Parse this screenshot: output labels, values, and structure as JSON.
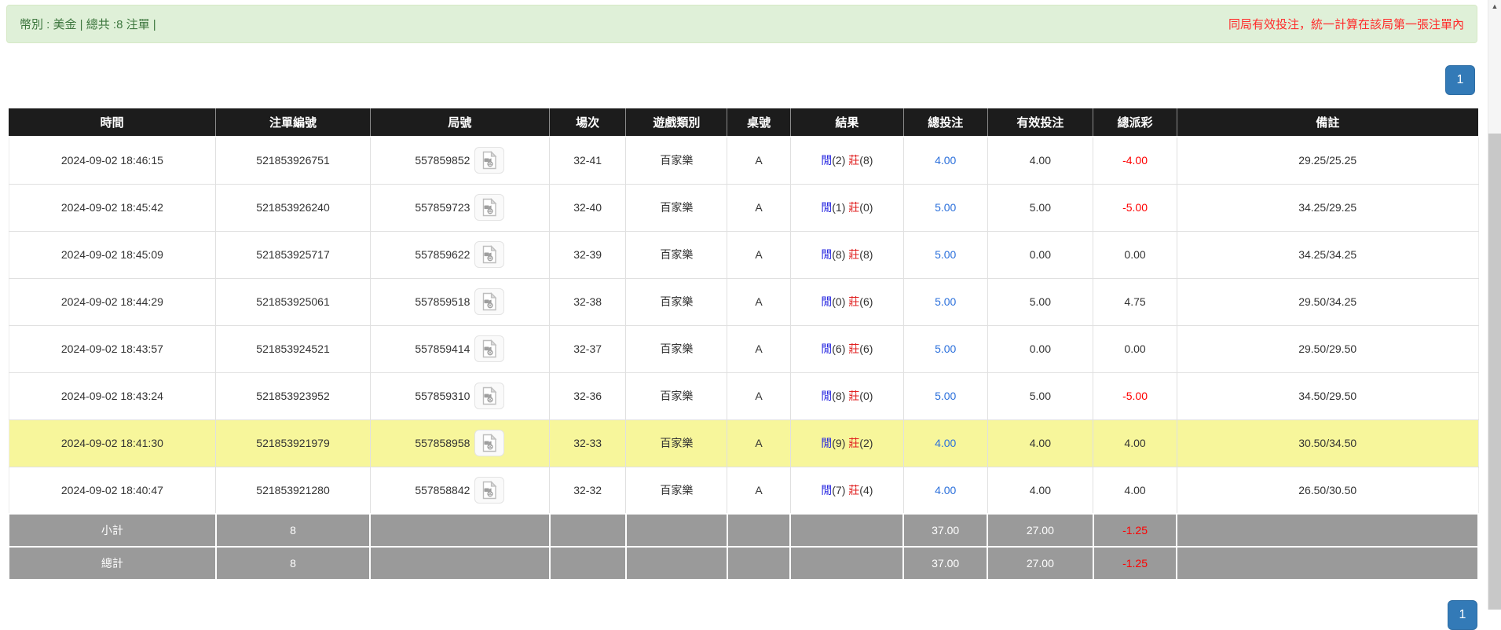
{
  "alert": {
    "left_text": "幣別 : 美金 | 總共 :8 注單 |",
    "right_text": "同局有效投注，統一計算在該局第一張注單內"
  },
  "pagination": {
    "page": "1"
  },
  "icons": {
    "video_replay": "video-file-icon",
    "scroll_up": "up-arrow"
  },
  "colors": {
    "pagination_blue": "#337ab7",
    "bet_amount_blue": "#2a6fdb",
    "player_blue": "#2525e0",
    "banker_red": "#e02020",
    "negative_red": "#ff0000",
    "highlight_yellow": "#f7f69b",
    "footer_gray": "#9a9a9a",
    "alert_bg_green": "#dff0d8",
    "alert_text_green": "#3c763d",
    "alert_text_red": "#ff2a2a",
    "header_black": "#1c1c1c"
  },
  "table": {
    "headers": [
      "時間",
      "注單編號",
      "局號",
      "場次",
      "遊戲類別",
      "桌號",
      "結果",
      "總投注",
      "有效投注",
      "總派彩",
      "備註"
    ],
    "result_labels": {
      "player": "閒",
      "banker": "莊"
    },
    "rows": [
      {
        "time": "2024-09-02 18:46:15",
        "bet_id": "521853926751",
        "round_id": "557859852",
        "session": "32-41",
        "game": "百家樂",
        "table_no": "A",
        "player_pts": "(2)",
        "banker_pts": "(8)",
        "total_bet": "4.00",
        "valid_bet": "4.00",
        "payout": "-4.00",
        "remark": "29.25/25.25",
        "highlight": false
      },
      {
        "time": "2024-09-02 18:45:42",
        "bet_id": "521853926240",
        "round_id": "557859723",
        "session": "32-40",
        "game": "百家樂",
        "table_no": "A",
        "player_pts": "(1)",
        "banker_pts": "(0)",
        "total_bet": "5.00",
        "valid_bet": "5.00",
        "payout": "-5.00",
        "remark": "34.25/29.25",
        "highlight": false
      },
      {
        "time": "2024-09-02 18:45:09",
        "bet_id": "521853925717",
        "round_id": "557859622",
        "session": "32-39",
        "game": "百家樂",
        "table_no": "A",
        "player_pts": "(8)",
        "banker_pts": "(8)",
        "total_bet": "5.00",
        "valid_bet": "0.00",
        "payout": "0.00",
        "remark": "34.25/34.25",
        "highlight": false
      },
      {
        "time": "2024-09-02 18:44:29",
        "bet_id": "521853925061",
        "round_id": "557859518",
        "session": "32-38",
        "game": "百家樂",
        "table_no": "A",
        "player_pts": "(0)",
        "banker_pts": "(6)",
        "total_bet": "5.00",
        "valid_bet": "5.00",
        "payout": "4.75",
        "remark": "29.50/34.25",
        "highlight": false
      },
      {
        "time": "2024-09-02 18:43:57",
        "bet_id": "521853924521",
        "round_id": "557859414",
        "session": "32-37",
        "game": "百家樂",
        "table_no": "A",
        "player_pts": "(6)",
        "banker_pts": "(6)",
        "total_bet": "5.00",
        "valid_bet": "0.00",
        "payout": "0.00",
        "remark": "29.50/29.50",
        "highlight": false
      },
      {
        "time": "2024-09-02 18:43:24",
        "bet_id": "521853923952",
        "round_id": "557859310",
        "session": "32-36",
        "game": "百家樂",
        "table_no": "A",
        "player_pts": "(8)",
        "banker_pts": "(0)",
        "total_bet": "5.00",
        "valid_bet": "5.00",
        "payout": "-5.00",
        "remark": "34.50/29.50",
        "highlight": false
      },
      {
        "time": "2024-09-02 18:41:30",
        "bet_id": "521853921979",
        "round_id": "557858958",
        "session": "32-33",
        "game": "百家樂",
        "table_no": "A",
        "player_pts": "(9)",
        "banker_pts": "(2)",
        "total_bet": "4.00",
        "valid_bet": "4.00",
        "payout": "4.00",
        "remark": "30.50/34.50",
        "highlight": true
      },
      {
        "time": "2024-09-02 18:40:47",
        "bet_id": "521853921280",
        "round_id": "557858842",
        "session": "32-32",
        "game": "百家樂",
        "table_no": "A",
        "player_pts": "(7)",
        "banker_pts": "(4)",
        "total_bet": "4.00",
        "valid_bet": "4.00",
        "payout": "4.00",
        "remark": "26.50/30.50",
        "highlight": false
      }
    ],
    "footer_rows": [
      {
        "cells": [
          "小計",
          "8",
          "",
          "",
          "",
          "",
          "",
          "37.00",
          "27.00",
          "-1.25",
          ""
        ]
      },
      {
        "cells": [
          "總計",
          "8",
          "",
          "",
          "",
          "",
          "",
          "37.00",
          "27.00",
          "-1.25",
          ""
        ]
      }
    ]
  }
}
